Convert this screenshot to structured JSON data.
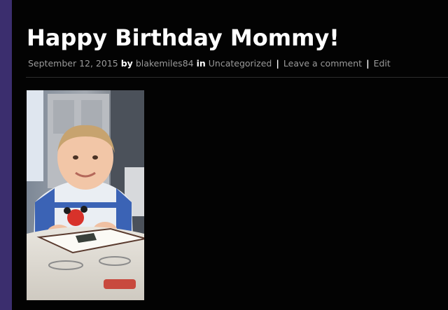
{
  "post": {
    "title": "Happy Birthday Mommy!",
    "meta": {
      "date": "September 12, 2015",
      "by_label": "by",
      "author": "blakemiles84",
      "in_label": "in",
      "category": "Uncategorized",
      "separator": "|",
      "comment_link": "Leave a comment",
      "edit_link": "Edit"
    },
    "photo": {
      "icon": "toddler-photo"
    }
  },
  "colors": {
    "background": "#030303",
    "sidebar": "#3b2e6e",
    "title": "#ffffff",
    "meta_text": "#9a9a9a"
  }
}
